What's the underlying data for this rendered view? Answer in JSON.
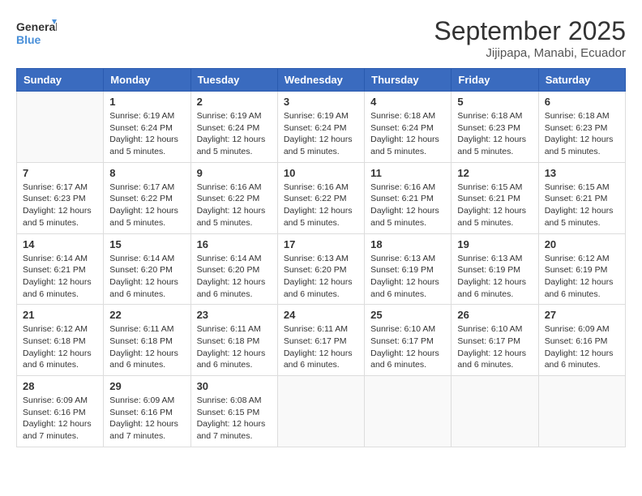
{
  "logo": {
    "text_general": "General",
    "text_blue": "Blue"
  },
  "header": {
    "month_title": "September 2025",
    "subtitle": "Jijipapa, Manabi, Ecuador"
  },
  "weekdays": [
    "Sunday",
    "Monday",
    "Tuesday",
    "Wednesday",
    "Thursday",
    "Friday",
    "Saturday"
  ],
  "weeks": [
    [
      {
        "day": "",
        "info": ""
      },
      {
        "day": "1",
        "info": "Sunrise: 6:19 AM\nSunset: 6:24 PM\nDaylight: 12 hours\nand 5 minutes."
      },
      {
        "day": "2",
        "info": "Sunrise: 6:19 AM\nSunset: 6:24 PM\nDaylight: 12 hours\nand 5 minutes."
      },
      {
        "day": "3",
        "info": "Sunrise: 6:19 AM\nSunset: 6:24 PM\nDaylight: 12 hours\nand 5 minutes."
      },
      {
        "day": "4",
        "info": "Sunrise: 6:18 AM\nSunset: 6:24 PM\nDaylight: 12 hours\nand 5 minutes."
      },
      {
        "day": "5",
        "info": "Sunrise: 6:18 AM\nSunset: 6:23 PM\nDaylight: 12 hours\nand 5 minutes."
      },
      {
        "day": "6",
        "info": "Sunrise: 6:18 AM\nSunset: 6:23 PM\nDaylight: 12 hours\nand 5 minutes."
      }
    ],
    [
      {
        "day": "7",
        "info": "Sunrise: 6:17 AM\nSunset: 6:23 PM\nDaylight: 12 hours\nand 5 minutes."
      },
      {
        "day": "8",
        "info": "Sunrise: 6:17 AM\nSunset: 6:22 PM\nDaylight: 12 hours\nand 5 minutes."
      },
      {
        "day": "9",
        "info": "Sunrise: 6:16 AM\nSunset: 6:22 PM\nDaylight: 12 hours\nand 5 minutes."
      },
      {
        "day": "10",
        "info": "Sunrise: 6:16 AM\nSunset: 6:22 PM\nDaylight: 12 hours\nand 5 minutes."
      },
      {
        "day": "11",
        "info": "Sunrise: 6:16 AM\nSunset: 6:21 PM\nDaylight: 12 hours\nand 5 minutes."
      },
      {
        "day": "12",
        "info": "Sunrise: 6:15 AM\nSunset: 6:21 PM\nDaylight: 12 hours\nand 5 minutes."
      },
      {
        "day": "13",
        "info": "Sunrise: 6:15 AM\nSunset: 6:21 PM\nDaylight: 12 hours\nand 5 minutes."
      }
    ],
    [
      {
        "day": "14",
        "info": "Sunrise: 6:14 AM\nSunset: 6:21 PM\nDaylight: 12 hours\nand 6 minutes."
      },
      {
        "day": "15",
        "info": "Sunrise: 6:14 AM\nSunset: 6:20 PM\nDaylight: 12 hours\nand 6 minutes."
      },
      {
        "day": "16",
        "info": "Sunrise: 6:14 AM\nSunset: 6:20 PM\nDaylight: 12 hours\nand 6 minutes."
      },
      {
        "day": "17",
        "info": "Sunrise: 6:13 AM\nSunset: 6:20 PM\nDaylight: 12 hours\nand 6 minutes."
      },
      {
        "day": "18",
        "info": "Sunrise: 6:13 AM\nSunset: 6:19 PM\nDaylight: 12 hours\nand 6 minutes."
      },
      {
        "day": "19",
        "info": "Sunrise: 6:13 AM\nSunset: 6:19 PM\nDaylight: 12 hours\nand 6 minutes."
      },
      {
        "day": "20",
        "info": "Sunrise: 6:12 AM\nSunset: 6:19 PM\nDaylight: 12 hours\nand 6 minutes."
      }
    ],
    [
      {
        "day": "21",
        "info": "Sunrise: 6:12 AM\nSunset: 6:18 PM\nDaylight: 12 hours\nand 6 minutes."
      },
      {
        "day": "22",
        "info": "Sunrise: 6:11 AM\nSunset: 6:18 PM\nDaylight: 12 hours\nand 6 minutes."
      },
      {
        "day": "23",
        "info": "Sunrise: 6:11 AM\nSunset: 6:18 PM\nDaylight: 12 hours\nand 6 minutes."
      },
      {
        "day": "24",
        "info": "Sunrise: 6:11 AM\nSunset: 6:17 PM\nDaylight: 12 hours\nand 6 minutes."
      },
      {
        "day": "25",
        "info": "Sunrise: 6:10 AM\nSunset: 6:17 PM\nDaylight: 12 hours\nand 6 minutes."
      },
      {
        "day": "26",
        "info": "Sunrise: 6:10 AM\nSunset: 6:17 PM\nDaylight: 12 hours\nand 6 minutes."
      },
      {
        "day": "27",
        "info": "Sunrise: 6:09 AM\nSunset: 6:16 PM\nDaylight: 12 hours\nand 6 minutes."
      }
    ],
    [
      {
        "day": "28",
        "info": "Sunrise: 6:09 AM\nSunset: 6:16 PM\nDaylight: 12 hours\nand 7 minutes."
      },
      {
        "day": "29",
        "info": "Sunrise: 6:09 AM\nSunset: 6:16 PM\nDaylight: 12 hours\nand 7 minutes."
      },
      {
        "day": "30",
        "info": "Sunrise: 6:08 AM\nSunset: 6:15 PM\nDaylight: 12 hours\nand 7 minutes."
      },
      {
        "day": "",
        "info": ""
      },
      {
        "day": "",
        "info": ""
      },
      {
        "day": "",
        "info": ""
      },
      {
        "day": "",
        "info": ""
      }
    ]
  ]
}
